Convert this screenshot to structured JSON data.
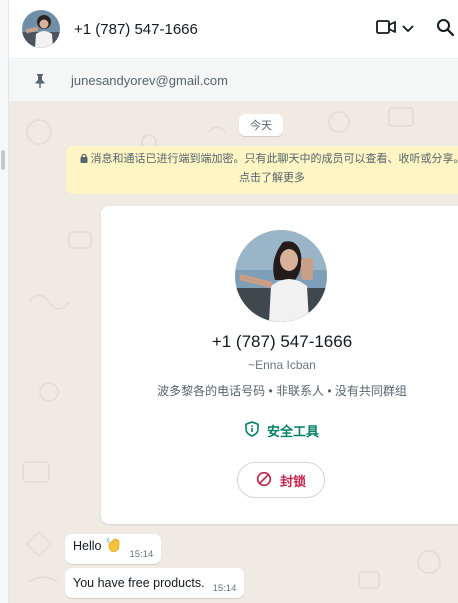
{
  "header": {
    "contact_name": "+1 (787) 547-1666",
    "icons": [
      "video-call-icon",
      "chevron-down-icon",
      "search-icon"
    ]
  },
  "pinned": {
    "icon": "pin-icon",
    "text": "junesandyorev@gmail.com"
  },
  "chat": {
    "date_chip": "今天",
    "encryption_notice": "消息和通话已进行端到端加密。只有此聊天中的成员可以查看、收听或分享。点击了解更多",
    "contact_card": {
      "phone": "+1 (787) 547-1666",
      "push_name": "~Enna Icban",
      "info": "波多黎各的电话号码 • 非联系人 • 没有共同群组",
      "safety_tools_label": "安全工具",
      "block_label": "封锁"
    },
    "messages": [
      {
        "text": "Hello",
        "emoji": "wave-emoji",
        "time": "15:14"
      },
      {
        "text": "You have free products.",
        "time": "15:14"
      }
    ]
  },
  "colors": {
    "accent_green": "#008069",
    "block_red": "#c0284f",
    "chat_bg": "#efeae2",
    "notice_bg": "#fff5c4"
  }
}
